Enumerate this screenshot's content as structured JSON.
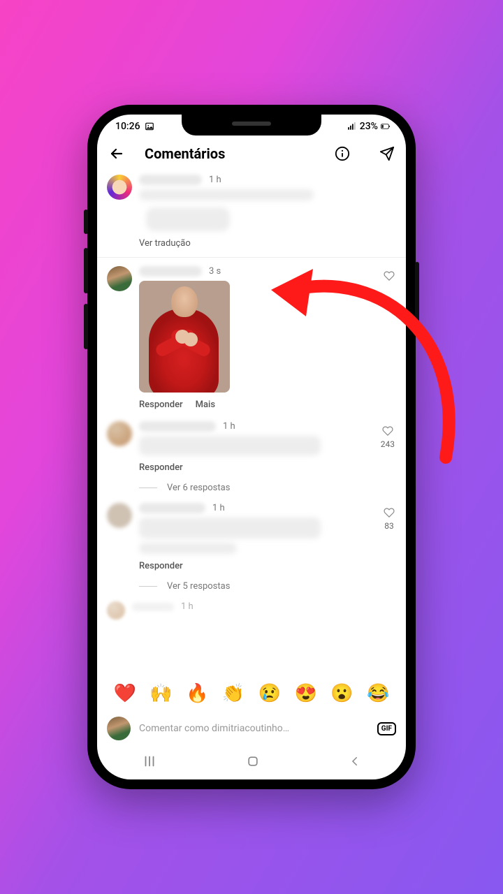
{
  "status": {
    "time": "10:26",
    "battery_text": "23%"
  },
  "header": {
    "title": "Comentários"
  },
  "comments": [
    {
      "timestamp": "1 h",
      "see_translation": "Ver tradução"
    },
    {
      "timestamp": "3 s",
      "reply": "Responder",
      "more": "Mais"
    },
    {
      "timestamp": "1 h",
      "reply": "Responder",
      "likes": "243",
      "see_replies": "Ver 6 respostas"
    },
    {
      "timestamp": "1 h",
      "reply": "Responder",
      "likes": "83",
      "see_replies": "Ver 5 respostas"
    },
    {
      "timestamp": "1 h"
    }
  ],
  "emojis": [
    "❤️",
    "🙌",
    "🔥",
    "👏",
    "😢",
    "😍",
    "😮",
    "😂"
  ],
  "composer": {
    "placeholder": "Comentar como dimitriacoutinho…",
    "gif_label": "GIF"
  }
}
